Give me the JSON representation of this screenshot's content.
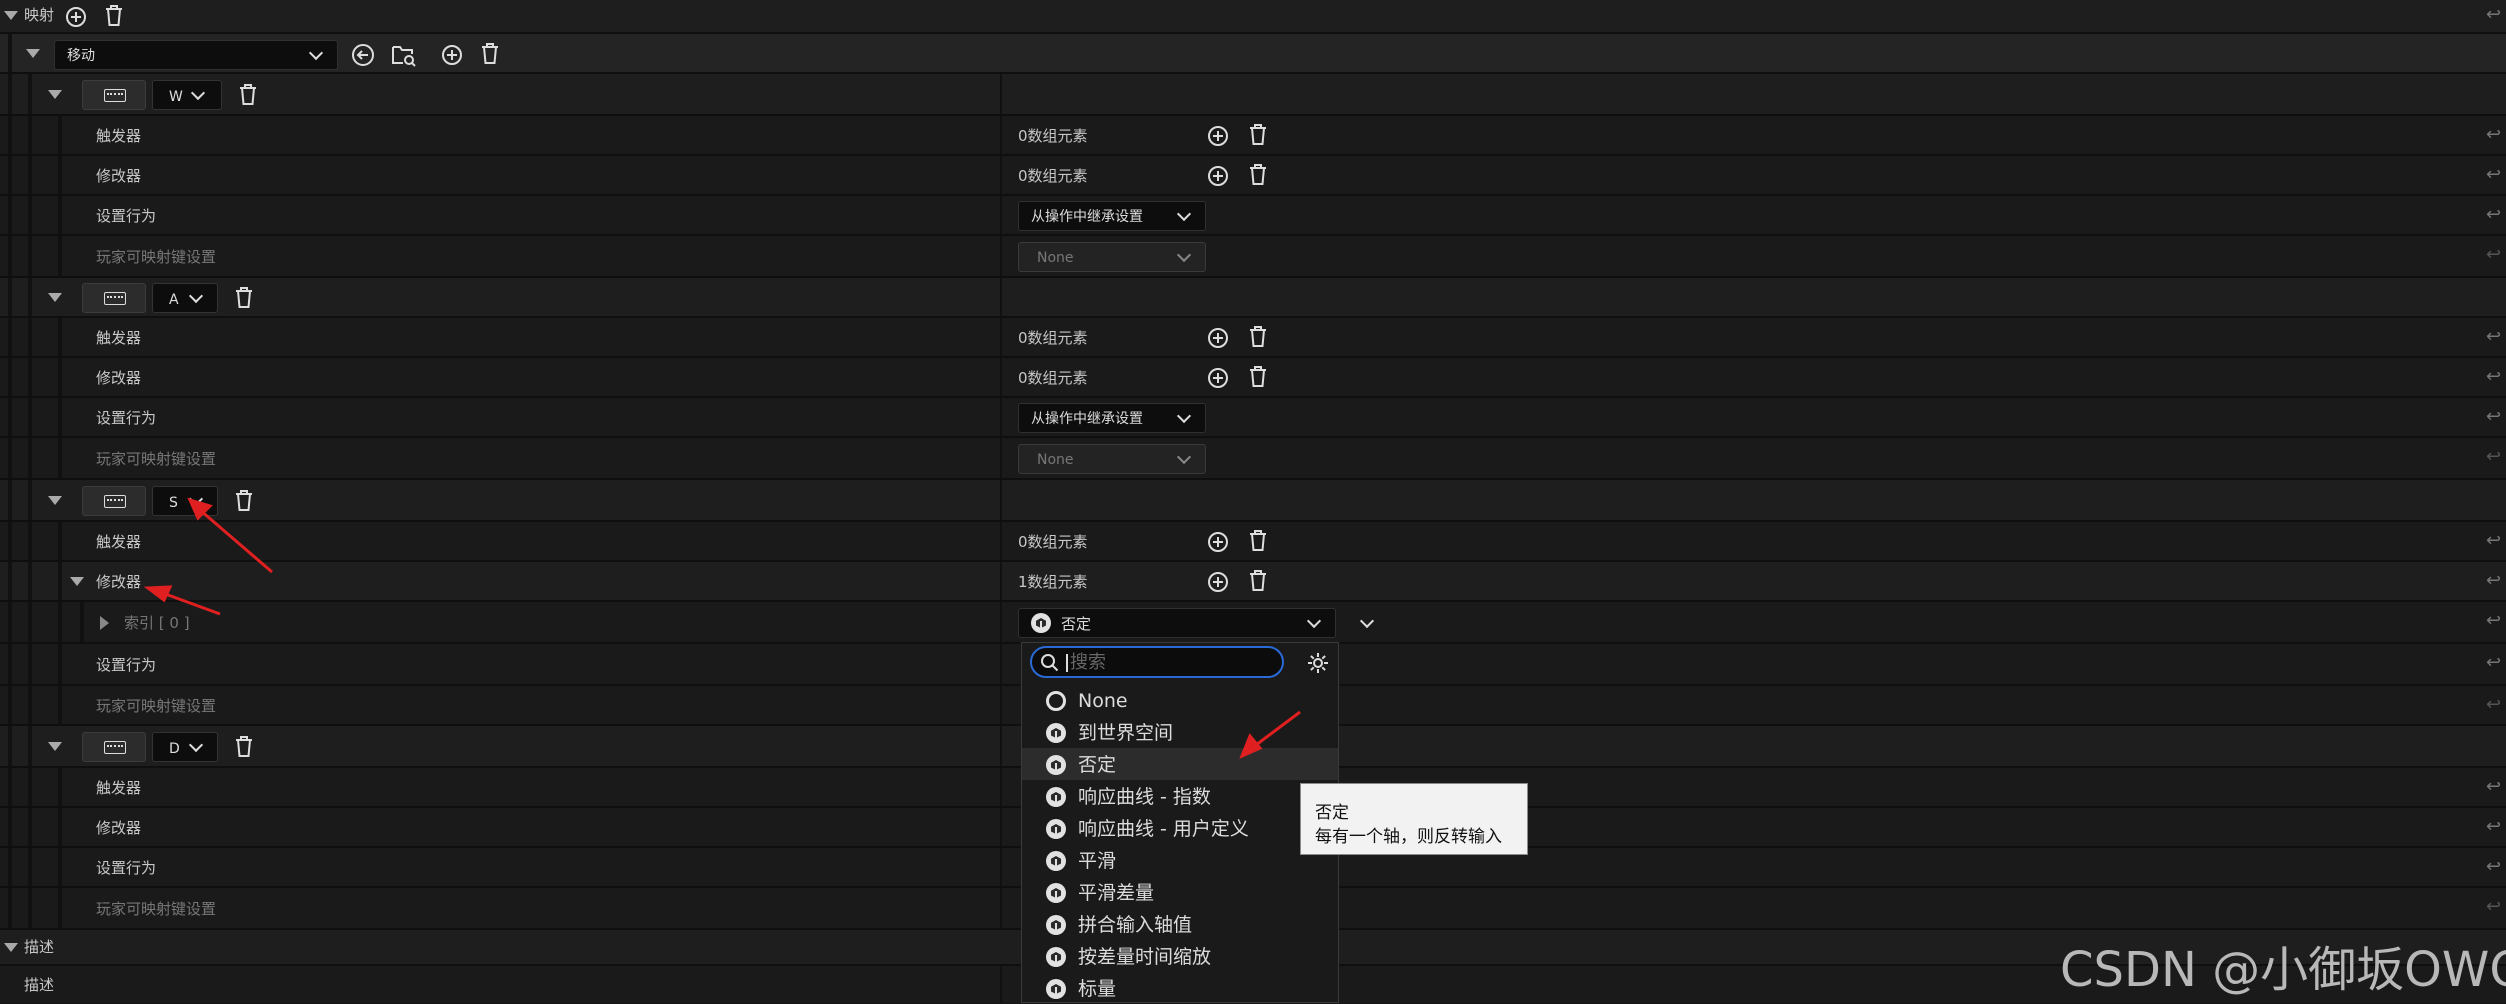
{
  "mapping_section": {
    "label": "映射",
    "add_icon": "plus-circle-icon",
    "delete_icon": "trash-icon"
  },
  "action": {
    "selected": "移动",
    "icons": [
      "back-arrow-icon",
      "folder-search-icon",
      "plus-circle-icon",
      "trash-icon"
    ]
  },
  "keys": [
    {
      "key": "W",
      "trigger_label": "触发器",
      "trigger_value": "0数组元素",
      "modifier_label": "修改器",
      "modifier_value": "0数组元素",
      "behavior_label": "设置行为",
      "behavior_value": "从操作中继承设置",
      "player_label": "玩家可映射键设置",
      "player_value": "None"
    },
    {
      "key": "A",
      "trigger_label": "触发器",
      "trigger_value": "0数组元素",
      "modifier_label": "修改器",
      "modifier_value": "0数组元素",
      "behavior_label": "设置行为",
      "behavior_value": "从操作中继承设置",
      "player_label": "玩家可映射键设置",
      "player_value": "None"
    },
    {
      "key": "S",
      "trigger_label": "触发器",
      "trigger_value": "0数组元素",
      "modifier_label": "修改器",
      "modifier_value": "1数组元素",
      "index_label": "索引 [ 0 ]",
      "index_value": "否定",
      "behavior_label": "设置行为",
      "player_label": "玩家可映射键设置"
    },
    {
      "key": "D",
      "trigger_label": "触发器",
      "modifier_label": "修改器",
      "behavior_label": "设置行为",
      "player_label": "玩家可映射键设置"
    }
  ],
  "description_section": {
    "header": "描述",
    "field_label": "描述"
  },
  "dropdown": {
    "search_placeholder": "搜索",
    "items": [
      "None",
      "到世界空间",
      "否定",
      "响应曲线 - 指数",
      "响应曲线 - 用户定义",
      "平滑",
      "平滑差量",
      "拼合输入轴值",
      "按差量时间缩放",
      "标量"
    ],
    "highlighted": "否定"
  },
  "tooltip": {
    "title": "否定",
    "body": "每有一个轴，则反转输入"
  },
  "watermark": "CSDN @小御坂OWO",
  "colors": {
    "accent": "#2a6ad6",
    "annotation_arrow": "#e02020",
    "background": "#151515"
  }
}
